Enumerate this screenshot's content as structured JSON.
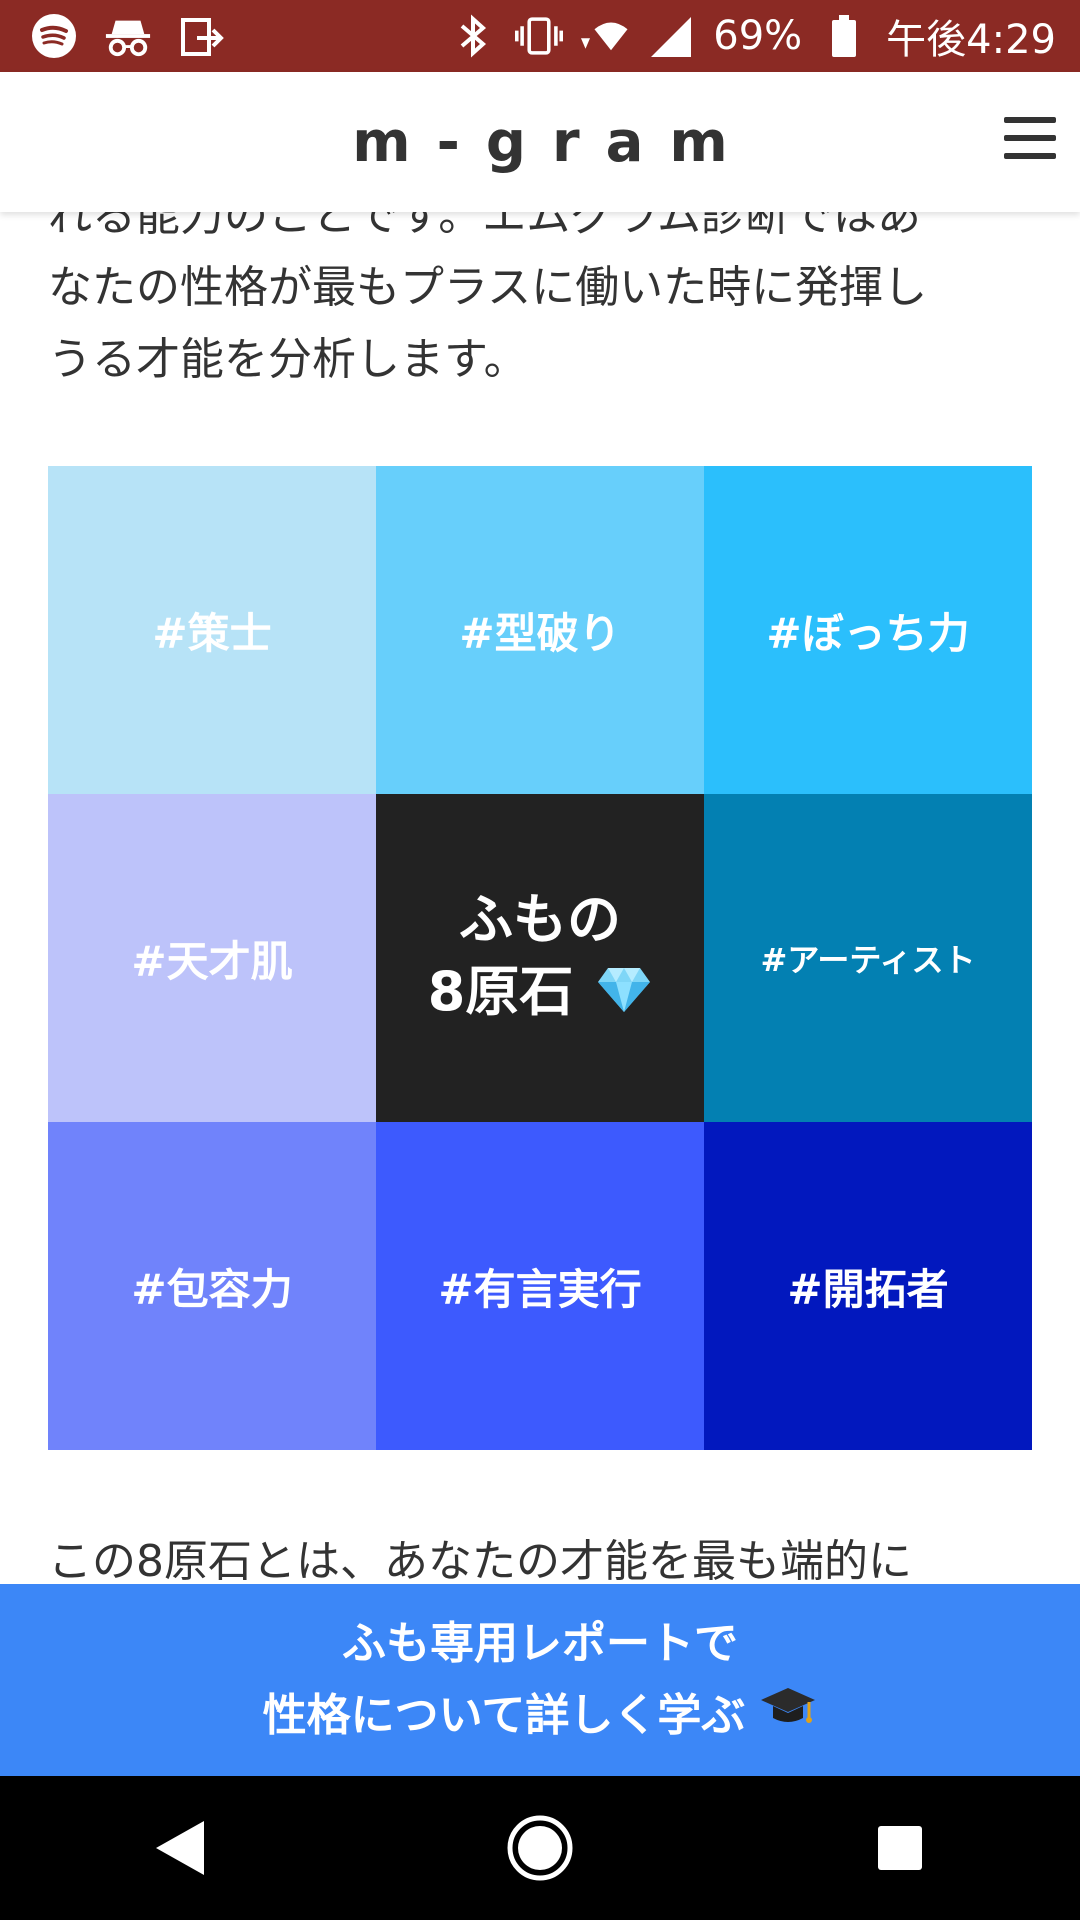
{
  "status_bar": {
    "battery": "69%",
    "time": "午後4:29",
    "icons": [
      "spotify-icon",
      "incognito-icon",
      "cast-icon",
      "bluetooth-icon",
      "vibrate-icon",
      "wifi-icon",
      "signal-icon",
      "battery-icon"
    ]
  },
  "header": {
    "logo": "m-gram",
    "menu_icon": "hamburger-menu-icon"
  },
  "content": {
    "intro_text": "れる能力のことです。エムグラム診断ではあ\nなたの性格が最もプラスに働いた時に発揮し\nうる才能を分析します。",
    "grid": {
      "cells": [
        {
          "label": "#策士",
          "color": "#b7e3f7"
        },
        {
          "label": "#型破り",
          "color": "#67cffb"
        },
        {
          "label": "#ぼっち力",
          "color": "#2bbffc"
        },
        {
          "label": "#天才肌",
          "color": "#bdc3fa"
        },
        {
          "label_line1": "ふもの",
          "label_line2": "8原石",
          "color": "#222222",
          "icon": "gem-icon"
        },
        {
          "label": "#アーティスト",
          "color": "#0380b2"
        },
        {
          "label": "#包容力",
          "color": "#7083fb"
        },
        {
          "label": "#有言実行",
          "color": "#3d5afe"
        },
        {
          "label": "#開拓者",
          "color": "#0218be"
        }
      ]
    },
    "outro_text": "この8原石とは、あなたの才能を最も端的に"
  },
  "cta": {
    "line1": "ふも専用レポートで",
    "line2": "性格について詳しく学ぶ",
    "icon": "graduation-cap-icon",
    "color": "#3c87f7"
  },
  "nav_bar": {
    "buttons": [
      "back-icon",
      "home-icon",
      "recents-icon"
    ]
  }
}
